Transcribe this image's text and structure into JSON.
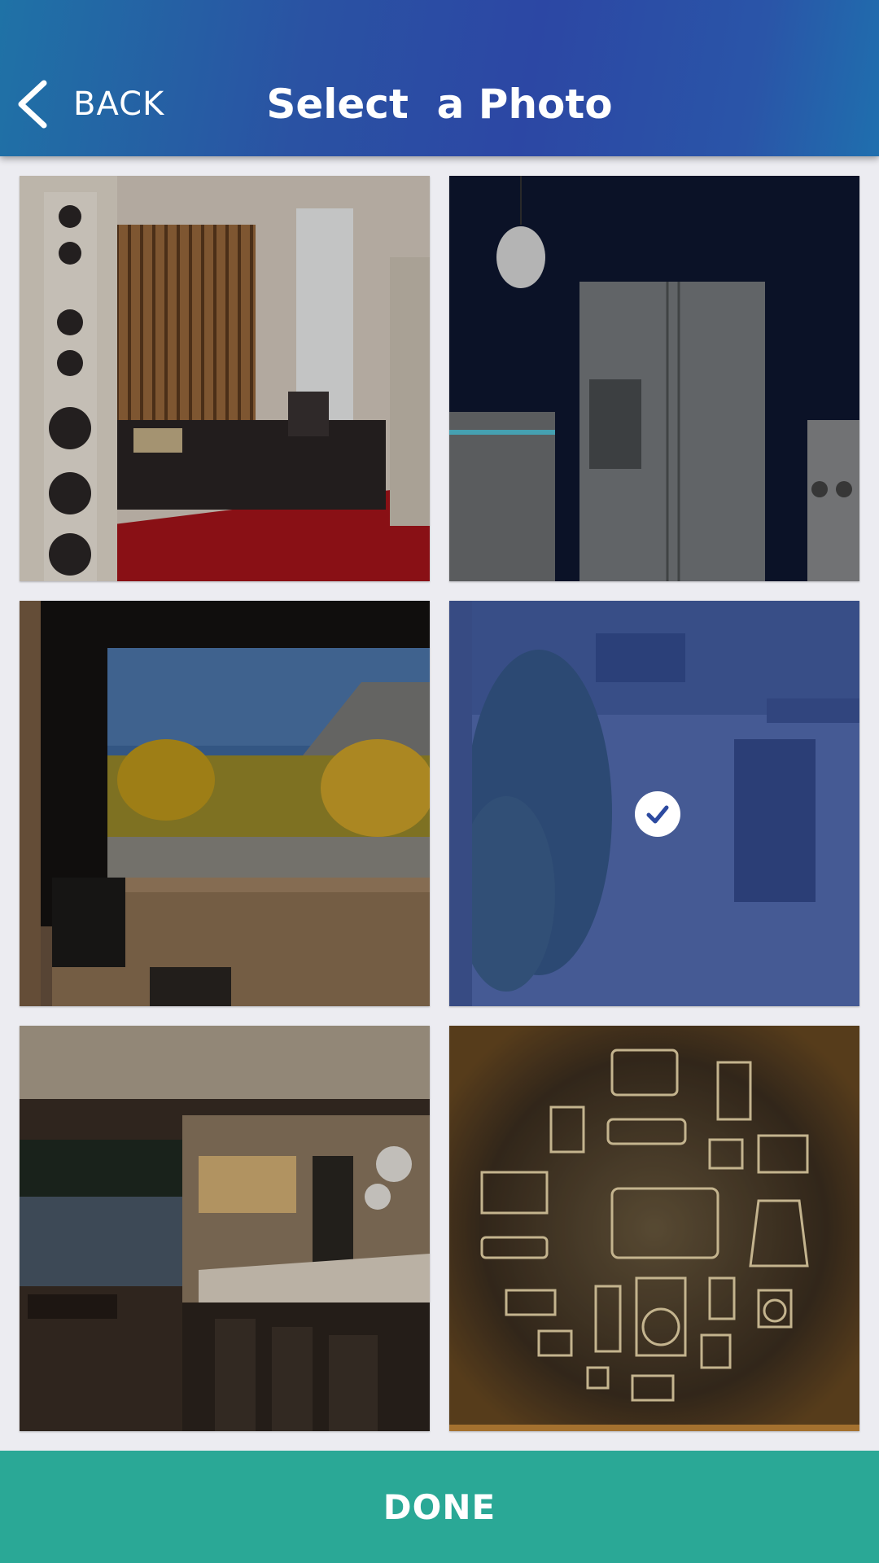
{
  "header": {
    "back_label": "BACK",
    "title": "Select  a Photo"
  },
  "photos": [
    {
      "subject": "hi-fi listening room with tower speakers",
      "selected": false
    },
    {
      "subject": "stainless steel refrigerators and range",
      "selected": false
    },
    {
      "subject": "home theater screen with autumn landscape",
      "selected": false
    },
    {
      "subject": "outdoor patio with dining table",
      "selected": true
    },
    {
      "subject": "modern kitchen with island and bar stools",
      "selected": false
    },
    {
      "subject": "line-art home appliance icons",
      "selected": false
    }
  ],
  "footer": {
    "done_label": "DONE"
  },
  "colors": {
    "header_start": "#1f72a6",
    "header_mid": "#2c47a4",
    "done_bar": "#2aa896",
    "selection_overlay": "#2c48a0",
    "background": "#ececf1"
  }
}
